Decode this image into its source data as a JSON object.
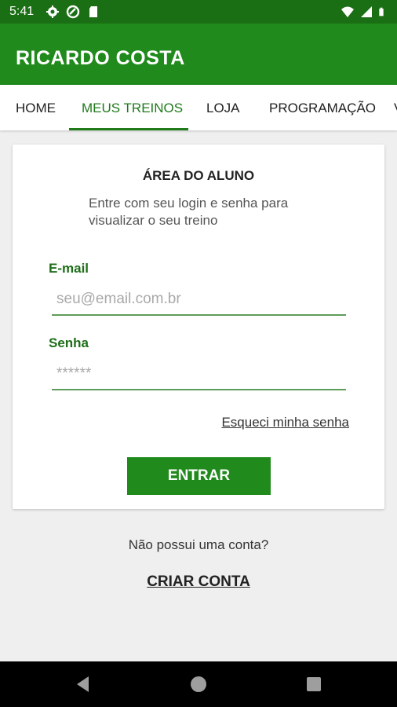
{
  "status_bar": {
    "time": "5:41",
    "icons_left": [
      "gear-icon",
      "data-saver-icon",
      "sd-card-icon"
    ],
    "icons_right": [
      "wifi-icon",
      "signal-icon",
      "battery-icon"
    ]
  },
  "app_bar": {
    "title": "RICARDO COSTA"
  },
  "tabs": [
    {
      "label": "HOME"
    },
    {
      "label": "MEUS TREINOS",
      "active": true
    },
    {
      "label": "LOJA"
    },
    {
      "label": "PROGRAMAÇÃO"
    },
    {
      "label": "V"
    }
  ],
  "login_card": {
    "title": "ÁREA DO ALUNO",
    "subtitle": "Entre com seu login e senha para visualizar o seu treino",
    "email_label": "E-mail",
    "email_placeholder": "seu@email.com.br",
    "password_label": "Senha",
    "password_placeholder": "******",
    "forgot_link": "Esqueci minha senha",
    "login_button": "ENTRAR"
  },
  "signup": {
    "prompt": "Não possui uma conta?",
    "link": "CRIAR CONTA"
  },
  "colors": {
    "status_bar": "#1a6e14",
    "app_bar": "#208a1c",
    "accent_text": "#1d6e18",
    "button": "#208a1c"
  },
  "nav_icons": [
    "back-icon",
    "home-icon",
    "recents-icon"
  ]
}
